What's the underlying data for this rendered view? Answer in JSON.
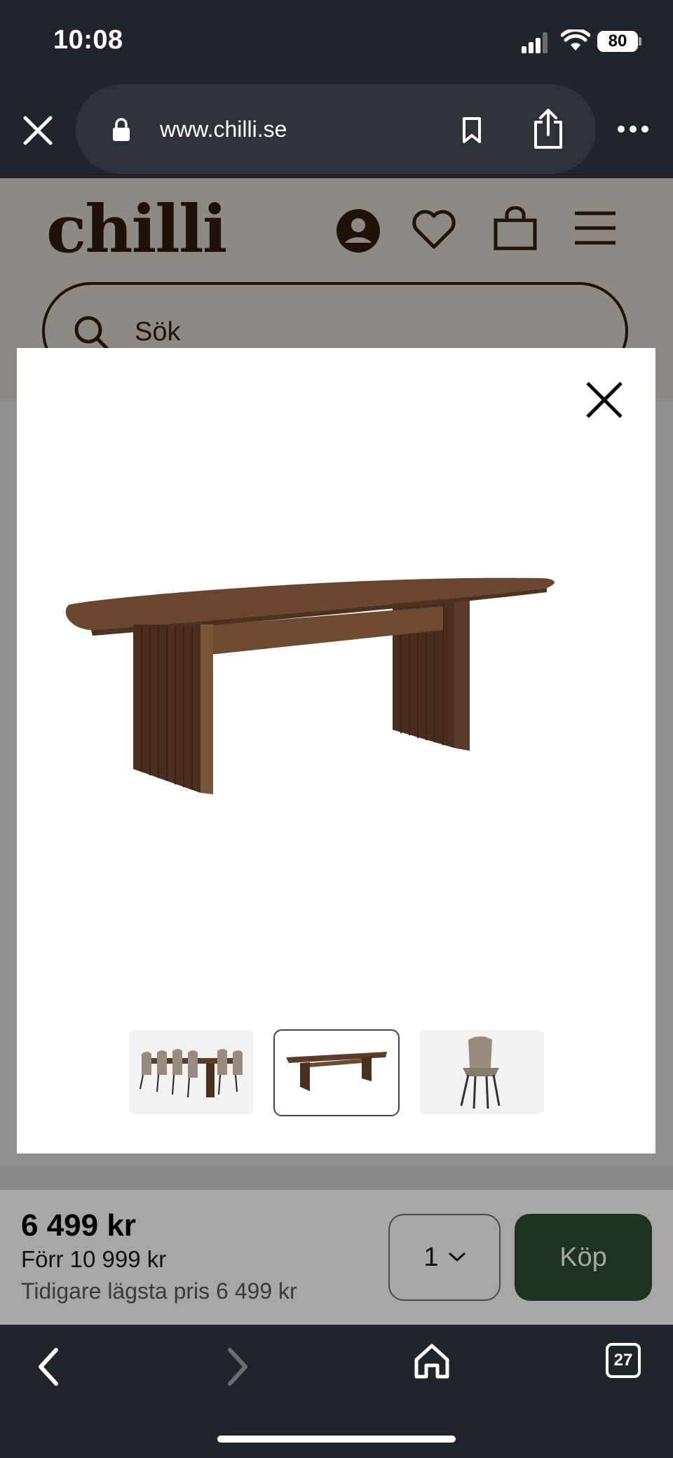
{
  "status": {
    "time": "10:08",
    "battery": "80"
  },
  "browser": {
    "url": "www.chilli.se",
    "tab_count": "27"
  },
  "site": {
    "logo": "chilli",
    "search_placeholder": "Sök"
  },
  "modal": {
    "thumbnails": [
      "dining-set",
      "table",
      "chair"
    ],
    "selected_thumbnail": 1
  },
  "buybar": {
    "price": "6 499 kr",
    "was_price": "Förr 10 999 kr",
    "lowest_price": "Tidigare lägsta pris 6 499 kr",
    "quantity": "1",
    "buy_label": "Köp"
  },
  "colors": {
    "brand": "#3a2010",
    "buy_button": "#1d3322",
    "chrome": "#22242c"
  }
}
